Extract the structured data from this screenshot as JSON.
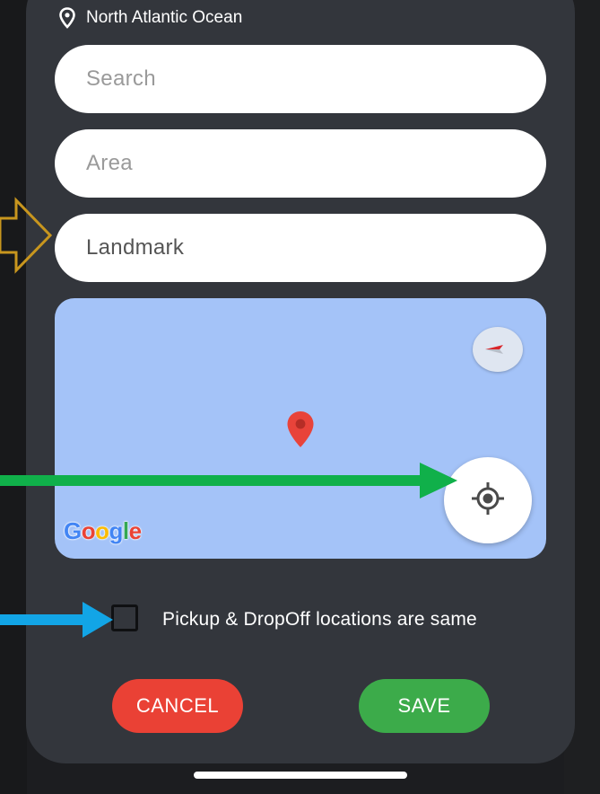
{
  "location": {
    "icon": "map-pin-outline-icon",
    "text": "North Atlantic Ocean"
  },
  "form": {
    "search_placeholder": "Search",
    "area_placeholder": "Area",
    "landmark_value": "Landmark"
  },
  "map": {
    "logo_letters": [
      "G",
      "o",
      "o",
      "g",
      "l",
      "e"
    ],
    "logo_colors": [
      "#4285F4",
      "#EA4335",
      "#FBBC05",
      "#4285F4",
      "#34A853",
      "#EA4335"
    ],
    "background": "#a4c3f8",
    "pin_color": "#e8433a",
    "compass_icon": "compass-icon",
    "locate_icon": "my-location-icon"
  },
  "checkbox": {
    "label": "Pickup & DropOff locations are same",
    "checked": false
  },
  "buttons": {
    "cancel_label": "CANCEL",
    "save_label": "SAVE"
  },
  "colors": {
    "panel": "#33363c",
    "cancel": "#ea4135",
    "save": "#3cab4a",
    "annotation_gold": "#c8961e",
    "annotation_green": "#10b04a",
    "annotation_blue": "#12a5e6"
  }
}
